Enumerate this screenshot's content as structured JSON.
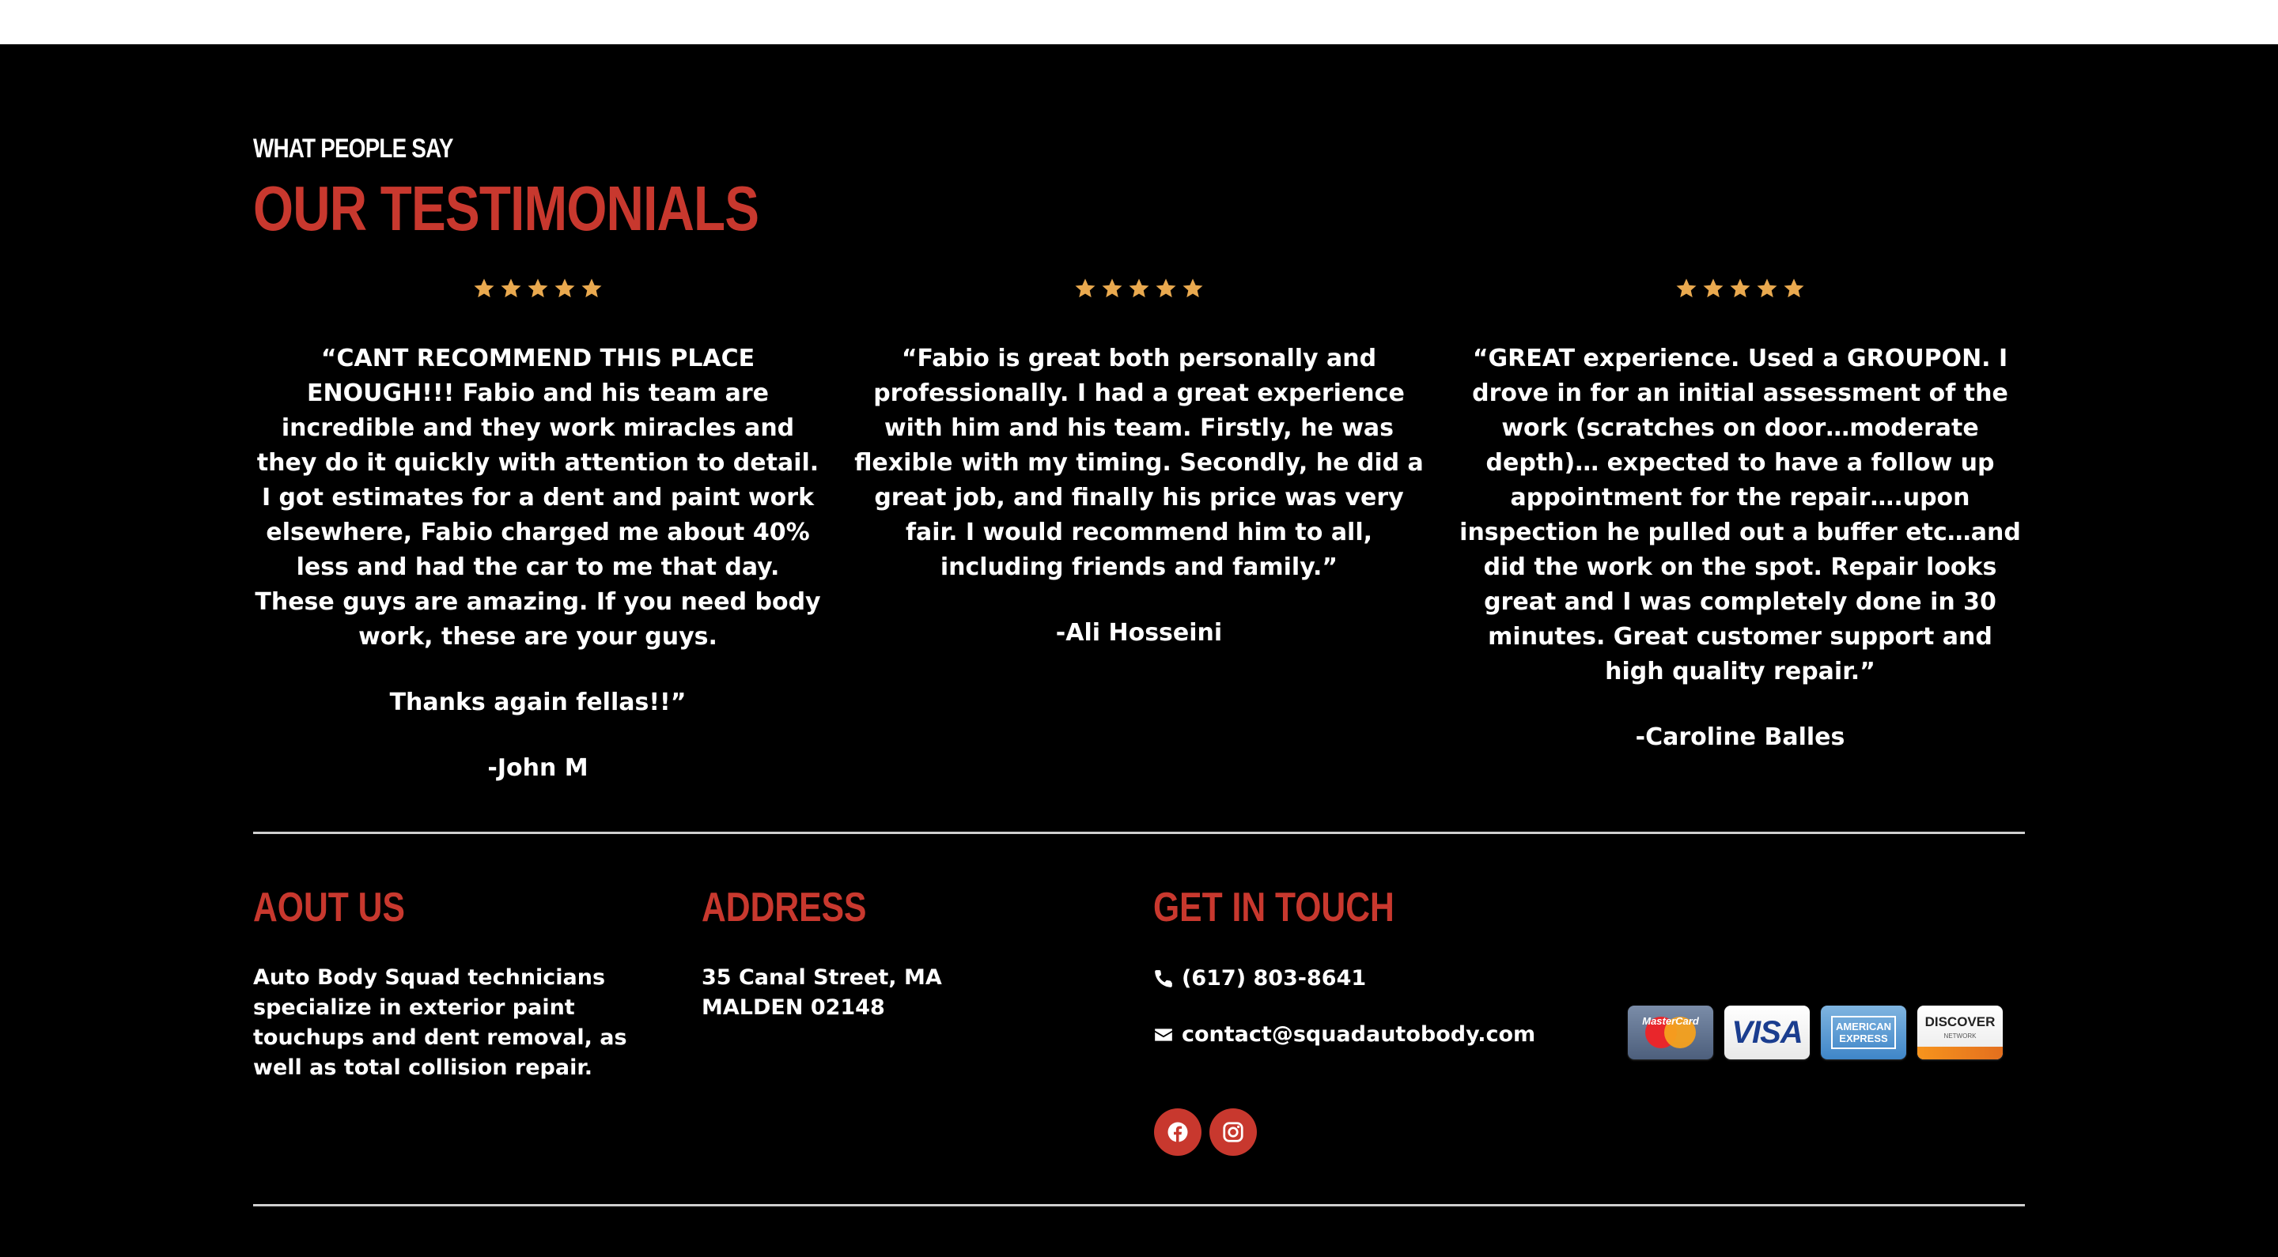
{
  "testimonials_section": {
    "eyebrow": "WHAT PEOPLE SAY",
    "title": "OUR TESTIMONIALS",
    "star_color": "#e9a94f",
    "rating": 5,
    "items": [
      {
        "paragraphs": [
          "“CANT RECOMMEND THIS PLACE ENOUGH!!! Fabio and his team are incredible and they work miracles and they do it quickly with attention to detail. I got estimates for a dent and paint work elsewhere, Fabio charged me about 40% less and had the car to me that day. These guys are amazing. If you need body work, these are your guys.",
          "Thanks again fellas!!”"
        ],
        "author": "-John M"
      },
      {
        "paragraphs": [
          "“Fabio is great both personally and professionally. I had a great experience with him and his team. Firstly, he was flexible with my timing. Secondly, he did a great job, and finally his price was very fair. I would recommend him to all, including friends and family.”"
        ],
        "author": "-Ali Hosseini"
      },
      {
        "paragraphs": [
          "“GREAT experience. Used a GROUPON. I drove in for an initial assessment of the work (scratches on door…moderate depth)… expected to have a follow up appointment for the repair….upon inspection he pulled out a buffer etc…and did the work on the spot. Repair looks great and I was completely done in 30 minutes. Great customer support and high quality repair.”"
        ],
        "author": "-Caroline Balles"
      }
    ]
  },
  "footer": {
    "about": {
      "title": "AOUT US",
      "text": "Auto Body Squad technicians specialize in exterior paint touchups and dent removal, as well as total collision repair."
    },
    "address": {
      "title": "ADDRESS",
      "line1": "35 Canal Street, MA",
      "line2": "MALDEN 02148"
    },
    "contact": {
      "title": "GET IN TOUCH",
      "phone": "(617) 803-8641",
      "email": "contact@squadautobody.com",
      "social": [
        "facebook-icon",
        "instagram-icon"
      ]
    },
    "payment_cards": {
      "mastercard": "MasterCard",
      "visa": "VISA",
      "amex_line1": "AMERICAN",
      "amex_line2": "EXPRESS",
      "discover": "DISCOVER",
      "discover_sub": "NETWORK"
    }
  },
  "colors": {
    "accent": "#c8382e",
    "background": "#000000",
    "text": "#ffffff",
    "divider": "#cfcfcf"
  }
}
